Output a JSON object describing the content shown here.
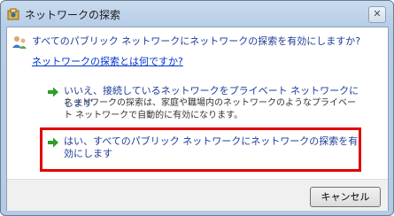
{
  "window": {
    "title": "ネットワークの探索",
    "close_label": "✕"
  },
  "main": {
    "question": "すべてのパブリック ネットワークにネットワークの探索を有効にしますか?",
    "help_link": "ネットワークの探索とは何ですか?"
  },
  "options": [
    {
      "title": "いいえ、接続しているネットワークをプライベート ネットワークにします",
      "description": "ネットワークの探索は、家庭や職場内のネットワークのようなプライベート ネットワークで自動的に有効になります。"
    },
    {
      "title": "はい、すべてのパブリック ネットワークにネットワークの探索を有効にします",
      "description": ""
    }
  ],
  "footer": {
    "cancel_label": "キャンセル"
  },
  "colors": {
    "highlight_border": "#e10000",
    "arrow": "#2e9d2b",
    "link": "#0033cc",
    "instruction": "#1f3c96"
  },
  "icons": {
    "title": "network-discovery-icon",
    "main": "users-network-icon",
    "option": "green-arrow-icon"
  }
}
